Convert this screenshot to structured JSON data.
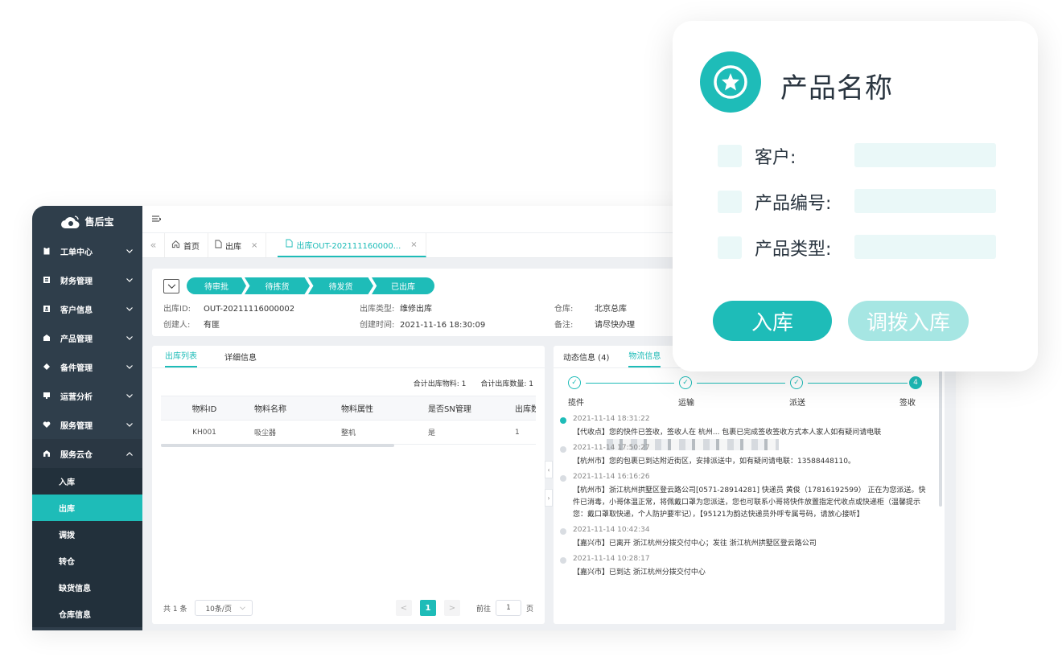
{
  "app": {
    "logo_text": "售后宝",
    "sidebar": {
      "items": [
        {
          "label": "工单中心",
          "icon": "clipboard-icon"
        },
        {
          "label": "财务管理",
          "icon": "finance-icon"
        },
        {
          "label": "客户信息",
          "icon": "customer-icon"
        },
        {
          "label": "产品管理",
          "icon": "product-icon"
        },
        {
          "label": "备件管理",
          "icon": "parts-icon"
        },
        {
          "label": "运营分析",
          "icon": "analytics-icon"
        },
        {
          "label": "服务管理",
          "icon": "service-icon"
        },
        {
          "label": "服务云仓",
          "icon": "warehouse-icon"
        }
      ],
      "subitems": [
        "入库",
        "出库",
        "调拨",
        "转仓",
        "缺货信息",
        "仓库信息"
      ],
      "active_subitem": "出库"
    },
    "tabs": {
      "home": "首页",
      "outbound": "出库",
      "detail": "出库OUT-202111160000...",
      "close": "×"
    },
    "status_steps": [
      "待审批",
      "待拣货",
      "待发货",
      "已出库"
    ],
    "info": {
      "outbound_id_label": "出库ID:",
      "outbound_id": "OUT-20211116000002",
      "type_label": "出库类型:",
      "type": "维修出库",
      "warehouse_label": "仓库:",
      "warehouse": "北京总库",
      "creator_label": "创建人:",
      "creator": "有匪",
      "created_label": "创建时间:",
      "created": "2021-11-16 18:30:09",
      "note_label": "备注:",
      "note": "请尽快办理"
    },
    "left_panel": {
      "tabs": [
        "出库列表",
        "详细信息"
      ],
      "sum_materials": "合计出库物料: 1",
      "sum_qty": "合计出库数量: 1",
      "columns": [
        "物料ID",
        "物料名称",
        "物料属性",
        "是否SN管理",
        "出库数"
      ],
      "rows": [
        [
          "KH001",
          "吸尘器",
          "整机",
          "是",
          "1"
        ]
      ],
      "pager": {
        "total": "共 1 条",
        "page_size": "10条/页",
        "prev": "<",
        "current": "1",
        "next": ">",
        "goto_label": "前往",
        "goto_value": "1",
        "page_unit": "页"
      }
    },
    "right_panel": {
      "tabs": [
        "动态信息 (4)",
        "物流信息"
      ],
      "progress": [
        {
          "label": "揽件",
          "state": "done"
        },
        {
          "label": "运输",
          "state": "done"
        },
        {
          "label": "派送",
          "state": "done"
        },
        {
          "label": "签收",
          "state": "current",
          "num": "4"
        }
      ],
      "timeline": [
        {
          "time": "2021-11-14 18:31:22",
          "text": "【代收点】您的快件已签收，签收人在 杭州...        包裹已完成签收签收方式本人家人如有疑问请电联",
          "active": true
        },
        {
          "time": "2021-11-14 17:50:27",
          "text": "【杭州市】您的包裹已到达附近街区，安排派送中，如有疑问请电联：13588448110。",
          "active": false
        },
        {
          "time": "2021-11-14 16:16:26",
          "text": "【杭州市】浙江杭州拱墅区登云路公司[0571-28914281] 快递员 黄俊（17816192599） 正在为您派送。快件已消毒，小哥体温正常，将佩戴口罩为您派送，您也可联系小哥将快件放置指定代收点或快递柜（温馨提示您：戴口罩取快递，个人防护要牢记），【95121为韵达快递员外呼专属号码，请放心接听】",
          "active": false
        },
        {
          "time": "2021-11-14 10:42:34",
          "text": "【嘉兴市】已离开 浙江杭州分拨交付中心；发往 浙江杭州拱墅区登云路公司",
          "active": false
        },
        {
          "time": "2021-11-14 10:28:17",
          "text": "【嘉兴市】已到达 浙江杭州分拨交付中心",
          "active": false
        }
      ]
    }
  },
  "card": {
    "title": "产品名称",
    "icon": "star-icon",
    "fields": [
      {
        "label": "客户:"
      },
      {
        "label": "产品编号:"
      },
      {
        "label": "产品类型:"
      }
    ],
    "primary_button": "入库",
    "secondary_button": "调拨入库"
  },
  "colors": {
    "accent": "#1ebcb8",
    "accent_light": "#a6e6e3",
    "sidebar_bg": "#2f3e4b",
    "field_bg": "#eaf8f8"
  }
}
